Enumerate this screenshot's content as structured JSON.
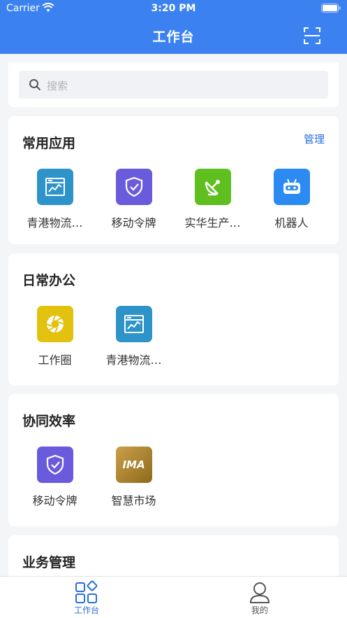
{
  "status_bar": {
    "carrier": "Carrier",
    "time": "3:20 PM"
  },
  "header": {
    "title": "工作台"
  },
  "search": {
    "placeholder": "搜索"
  },
  "sections": [
    {
      "title": "常用应用",
      "action": "管理",
      "apps": [
        {
          "label": "青港物流…",
          "icon": "chart-window-icon",
          "color": "#2e93c9"
        },
        {
          "label": "移动令牌",
          "icon": "shield-check-icon",
          "color": "#6a5bdc"
        },
        {
          "label": "实华生产…",
          "icon": "satellite-dish-icon",
          "color": "#5fbf1e"
        },
        {
          "label": "机器人",
          "icon": "robot-icon",
          "color": "#2b8bf2"
        }
      ]
    },
    {
      "title": "日常办公",
      "apps": [
        {
          "label": "工作圈",
          "icon": "aperture-icon",
          "color": "#e2c20e"
        },
        {
          "label": "青港物流…",
          "icon": "chart-window-icon",
          "color": "#2e93c9"
        }
      ]
    },
    {
      "title": "协同效率",
      "apps": [
        {
          "label": "移动令牌",
          "icon": "shield-check-icon",
          "color": "#6a5bdc"
        },
        {
          "label": "智慧市场",
          "icon": "ima-logo-icon",
          "color": "#b58a2a",
          "logo_text": "IMA"
        }
      ]
    },
    {
      "title": "业务管理",
      "apps": []
    }
  ],
  "tabbar": {
    "tabs": [
      {
        "label": "工作台",
        "icon": "grid-diamond-icon",
        "active": true,
        "color": "#2a6fdb"
      },
      {
        "label": "我的",
        "icon": "person-icon",
        "active": false,
        "color": "#555555"
      }
    ]
  },
  "colors": {
    "primary": "#3b82f0",
    "link": "#2a6fdb"
  }
}
